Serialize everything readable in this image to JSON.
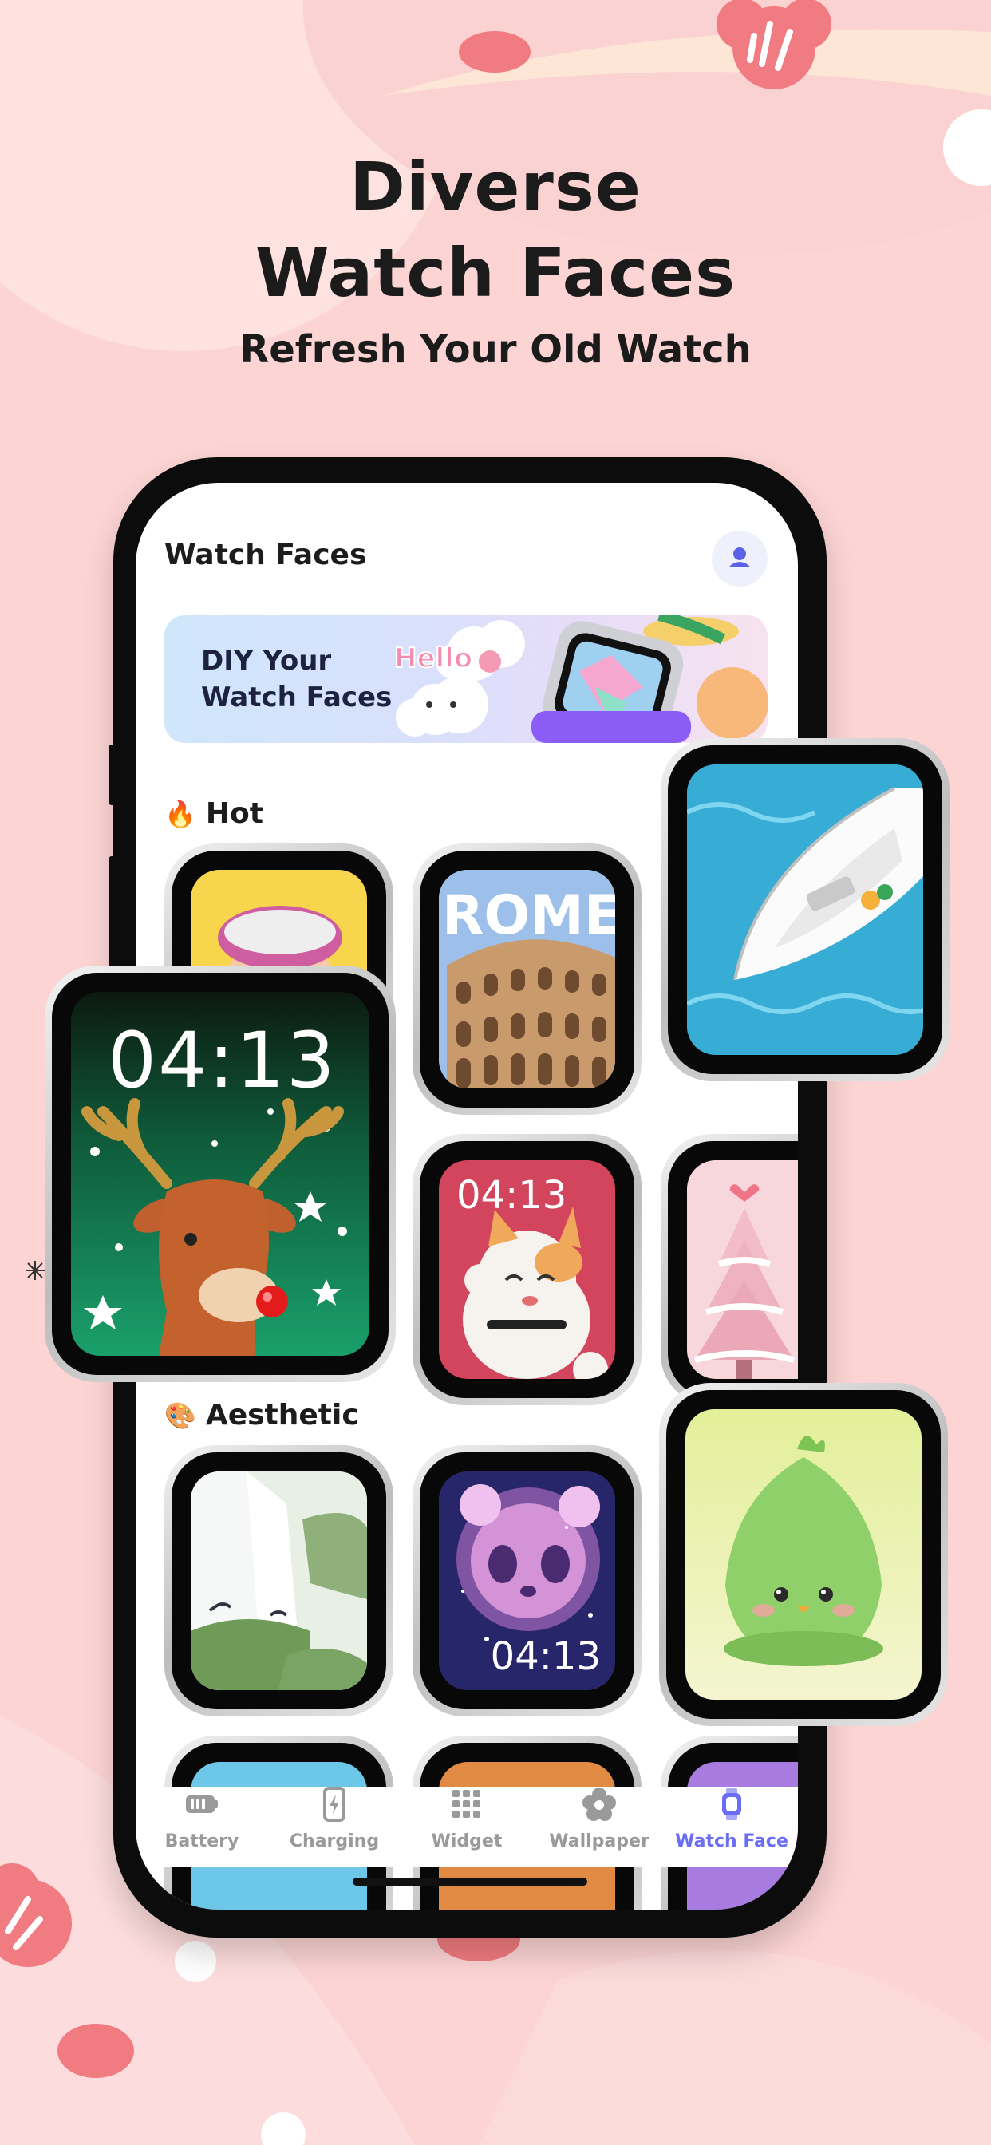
{
  "headline": {
    "line1": "Diverse",
    "line2": "Watch Faces",
    "subtitle": "Refresh Your Old Watch"
  },
  "app": {
    "title": "Watch Faces",
    "profile_icon": "user-icon"
  },
  "banner": {
    "title": "DIY Your\nWatch Faces",
    "sticker_text": "Hello"
  },
  "sections": [
    {
      "emoji": "🔥",
      "label": "Hot"
    },
    {
      "emoji": "🎨",
      "label": "Aesthetic"
    }
  ],
  "watch_faces": {
    "hot": [
      {
        "name": "cartoon-girl-sunglasses",
        "time": ""
      },
      {
        "name": "rome-colosseum",
        "text": "ROME",
        "time": ""
      },
      {
        "name": "yacht-ocean",
        "time": ""
      },
      {
        "name": "christmas-reindeer",
        "time": "04:13"
      },
      {
        "name": "lucky-cat",
        "time": "04:13"
      },
      {
        "name": "pink-christmas-tree",
        "time": ""
      }
    ],
    "aesthetic": [
      {
        "name": "waterfall-birds",
        "time": ""
      },
      {
        "name": "galaxy-panda",
        "time": "04:13"
      },
      {
        "name": "green-fluffy-chick",
        "time": ""
      }
    ]
  },
  "tabs": [
    {
      "label": "Battery",
      "icon": "battery-icon",
      "active": false
    },
    {
      "label": "Charging",
      "icon": "charging-icon",
      "active": false
    },
    {
      "label": "Widget",
      "icon": "widget-icon",
      "active": false
    },
    {
      "label": "Wallpaper",
      "icon": "wallpaper-icon",
      "active": false
    },
    {
      "label": "Watch Face",
      "icon": "watch-face-icon",
      "active": true
    }
  ],
  "colors": {
    "background": "#fcd4d4",
    "accent": "#6b6ef5",
    "flower": "#f07b80"
  }
}
